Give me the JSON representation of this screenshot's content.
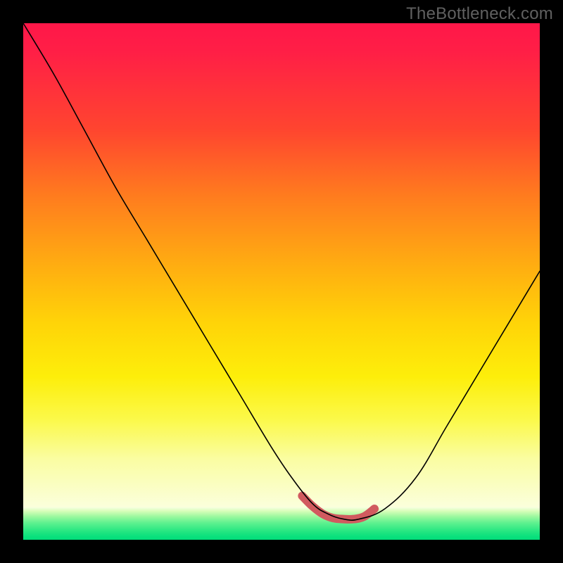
{
  "watermark": {
    "text": "TheBottleneck.com"
  },
  "colors": {
    "curve": "#000000",
    "highlight": "#d15a5f",
    "frame": "#000000"
  },
  "chart_data": {
    "type": "line",
    "title": "",
    "xlabel": "",
    "ylabel": "",
    "xlim": [
      0,
      100
    ],
    "ylim": [
      0,
      100
    ],
    "grid": false,
    "legend": false,
    "series": [
      {
        "name": "bottleneck-curve",
        "x": [
          0,
          6,
          12,
          18,
          24,
          30,
          36,
          42,
          48,
          52,
          56,
          59,
          62,
          65,
          70,
          76,
          82,
          88,
          94,
          100
        ],
        "values": [
          100,
          90,
          79,
          68,
          58,
          48,
          38,
          28,
          18,
          12,
          7,
          5,
          4,
          4,
          6,
          12,
          22,
          32,
          42,
          52
        ]
      },
      {
        "name": "optimal-region",
        "x": [
          54,
          56,
          58,
          60,
          62,
          64,
          66,
          68
        ],
        "values": [
          8.5,
          6.5,
          5.0,
          4.2,
          4.0,
          4.0,
          4.5,
          6.0
        ]
      }
    ],
    "notes": "Background encodes bottleneck severity: red (high) at top through yellow to green (optimal) near bottom. V-shaped curve; trough ≈ x 60–66. Highlighted salmon segment marks the optimal/no-bottleneck zone."
  }
}
